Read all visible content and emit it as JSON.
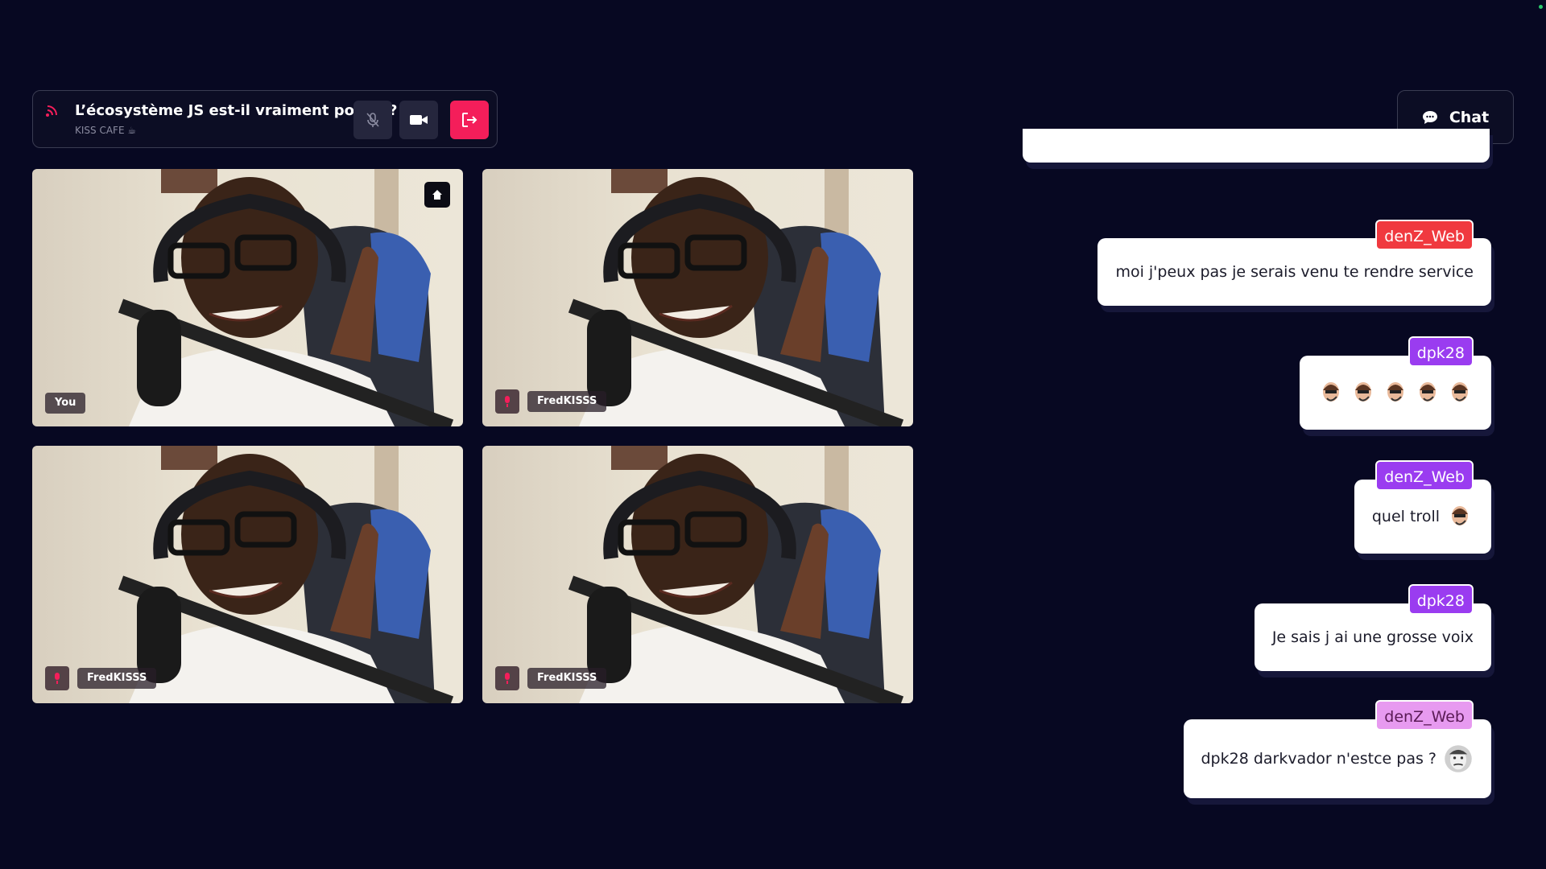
{
  "room": {
    "title": "L’écosystème JS est-il vraiment pourri ?",
    "subtitle": "KISS CAFE ☕",
    "icons": {
      "signal": "signal-icon",
      "mic": "mic-muted-icon",
      "camera": "camera-icon",
      "leave": "leave-icon"
    },
    "leave_color": "#f41e5a"
  },
  "chat_button": {
    "label": "Chat",
    "icon": "chat-bubble-icon"
  },
  "participants": [
    {
      "name": "You",
      "muted": false,
      "host": true
    },
    {
      "name": "FredKISSS",
      "muted": true,
      "host": false
    },
    {
      "name": "FredKISSS",
      "muted": true,
      "host": false
    },
    {
      "name": "FredKISSS",
      "muted": true,
      "host": false
    }
  ],
  "chat": {
    "messages": [
      {
        "author": "denZ_Web",
        "author_color": "#f0393f",
        "text": "moi j'peux pas je serais venu te rendre service",
        "emotes": 0
      },
      {
        "author": "dpk28",
        "author_color": "#9a3cf0",
        "text": "",
        "emotes": 5
      },
      {
        "author": "denZ_Web",
        "author_color": "#9a3cf0",
        "text": "quel troll",
        "emotes": 1
      },
      {
        "author": "dpk28",
        "author_color": "#9a3cf0",
        "text": "Je sais j ai une grosse voix",
        "emotes": 0
      },
      {
        "author": "denZ_Web",
        "author_color": "#e79af0",
        "text": "dpk28 darkvador n'estce pas ?",
        "emotes": 1
      }
    ]
  }
}
